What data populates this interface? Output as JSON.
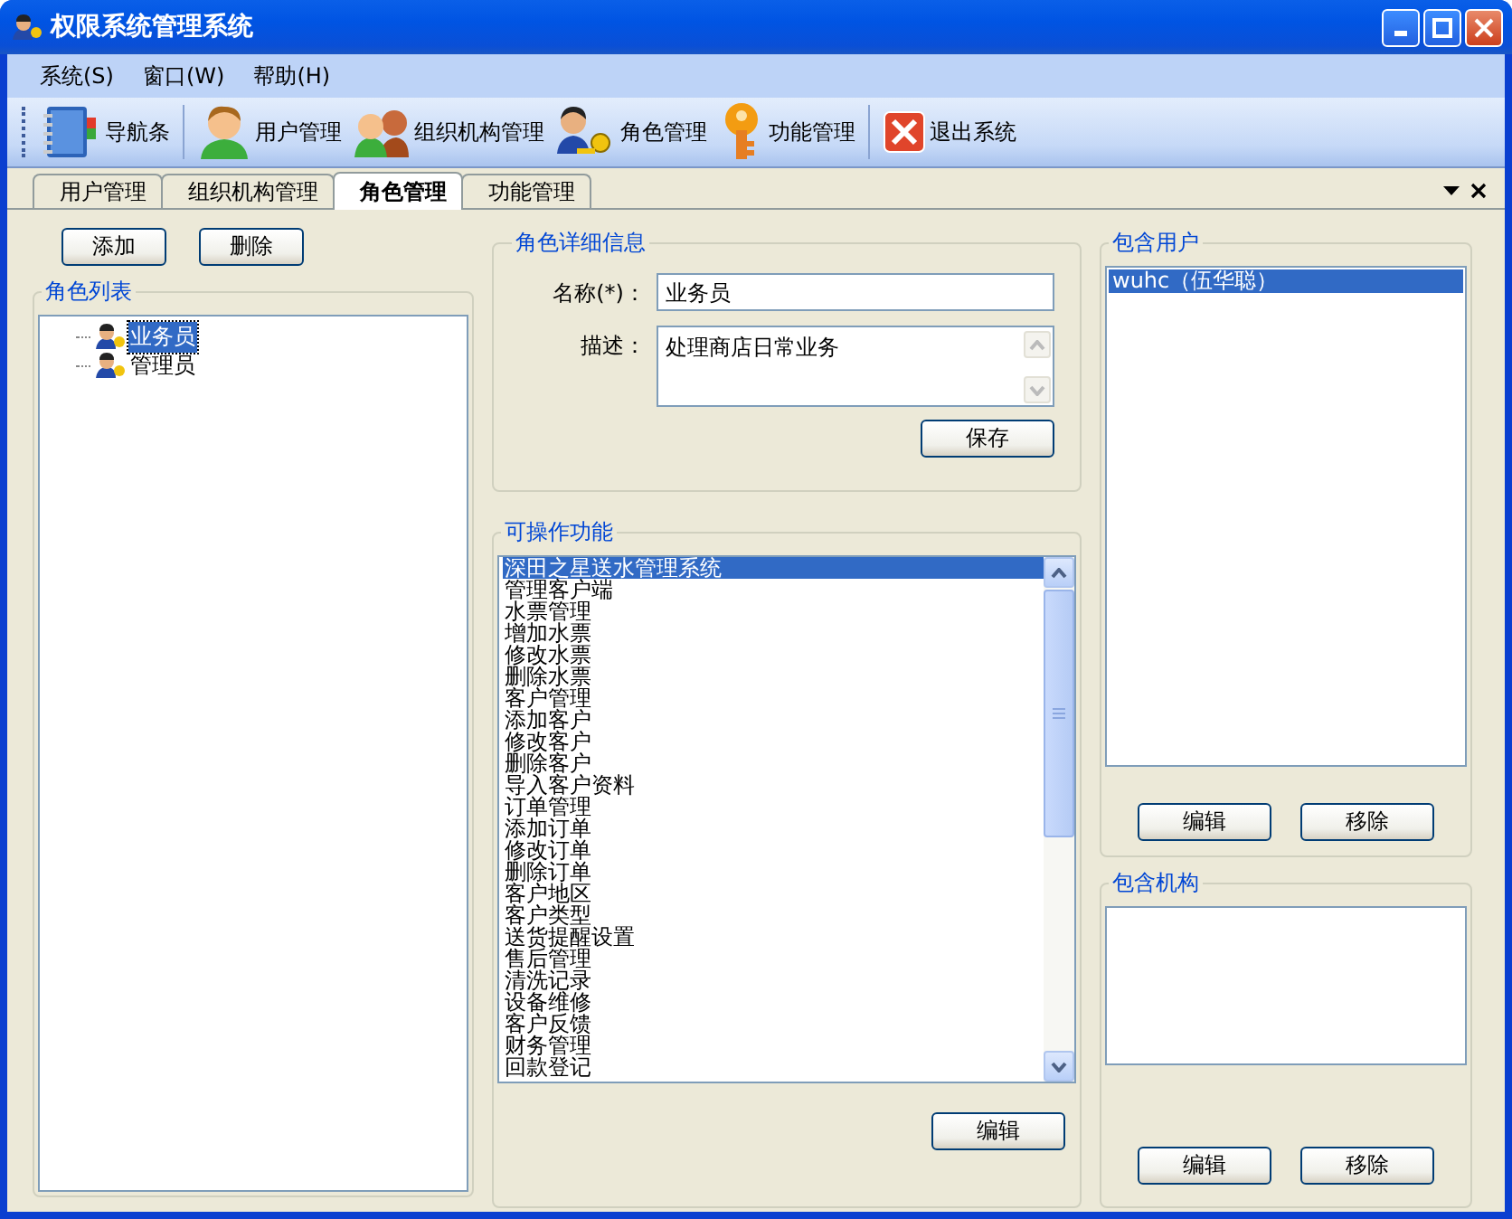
{
  "window": {
    "title": "权限系统管理系统"
  },
  "menu": [
    {
      "label": "系统(S)"
    },
    {
      "label": "窗口(W)"
    },
    {
      "label": "帮助(H)"
    }
  ],
  "toolbar": [
    {
      "label": "导航条",
      "kind": "book"
    },
    {
      "label": "用户管理",
      "kind": "user"
    },
    {
      "label": "组织机构管理",
      "kind": "group"
    },
    {
      "label": "角色管理",
      "kind": "role"
    },
    {
      "label": "功能管理",
      "kind": "key"
    },
    {
      "label": "退出系统",
      "kind": "exit"
    }
  ],
  "tabs": [
    {
      "label": "用户管理",
      "selected": false
    },
    {
      "label": "组织机构管理",
      "selected": false
    },
    {
      "label": "角色管理",
      "selected": true
    },
    {
      "label": "功能管理",
      "selected": false
    }
  ],
  "role_list": {
    "buttons": [
      "添加",
      "删除"
    ],
    "title": "角色列表",
    "items": [
      {
        "label": "业务员",
        "selected": true
      },
      {
        "label": "管理员",
        "selected": false
      }
    ]
  },
  "role_detail": {
    "title": "角色详细信息",
    "name_label": "名称(*)：",
    "name_value": "业务员",
    "desc_label": "描述：",
    "desc_value": "处理商店日常业务",
    "save_button": "保存"
  },
  "functions": {
    "title": "可操作功能",
    "items": [
      {
        "label": "深田之星送水管理系统",
        "selected": true
      },
      {
        "label": "管理客户端",
        "selected": false
      },
      {
        "label": "水票管理",
        "selected": false
      },
      {
        "label": "增加水票",
        "selected": false
      },
      {
        "label": "修改水票",
        "selected": false
      },
      {
        "label": "删除水票",
        "selected": false
      },
      {
        "label": "客户管理",
        "selected": false
      },
      {
        "label": "添加客户",
        "selected": false
      },
      {
        "label": "修改客户",
        "selected": false
      },
      {
        "label": "删除客户",
        "selected": false
      },
      {
        "label": "导入客户资料",
        "selected": false
      },
      {
        "label": "订单管理",
        "selected": false
      },
      {
        "label": "添加订单",
        "selected": false
      },
      {
        "label": "修改订单",
        "selected": false
      },
      {
        "label": "删除订单",
        "selected": false
      },
      {
        "label": "客户地区",
        "selected": false
      },
      {
        "label": "客户类型",
        "selected": false
      },
      {
        "label": "送货提醒设置",
        "selected": false
      },
      {
        "label": "售后管理",
        "selected": false
      },
      {
        "label": "清洗记录",
        "selected": false
      },
      {
        "label": "设备维修",
        "selected": false
      },
      {
        "label": "客户反馈",
        "selected": false
      },
      {
        "label": "财务管理",
        "selected": false
      },
      {
        "label": "回款登记",
        "selected": false
      }
    ],
    "edit_button": "编辑"
  },
  "users": {
    "title": "包含用户",
    "items": [
      {
        "label": "wuhc（伍华聪）",
        "selected": true
      }
    ],
    "buttons": [
      "编辑",
      "移除"
    ]
  },
  "orgs": {
    "title": "包含机构",
    "buttons": [
      "编辑",
      "移除"
    ]
  }
}
